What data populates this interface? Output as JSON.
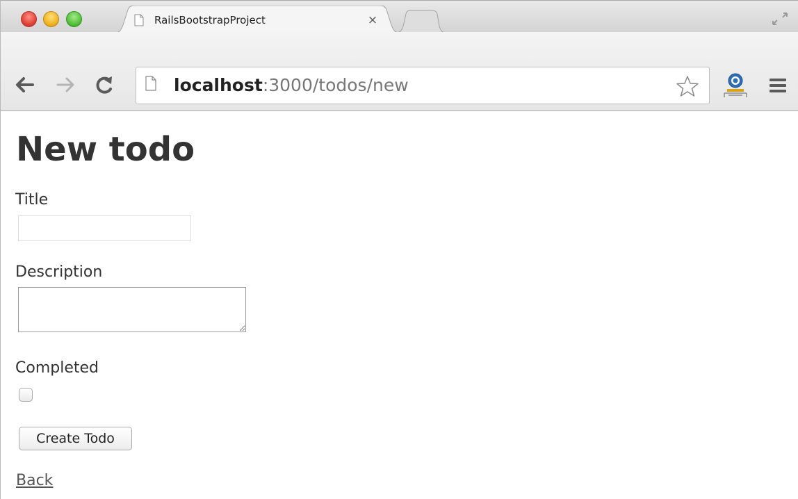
{
  "browser": {
    "tab": {
      "title": "RailsBootstrapProject",
      "close_glyph": "×"
    },
    "omnibox": {
      "host": "localhost",
      "rest": ":3000/todos/new"
    },
    "icons": {
      "back": "back-arrow-icon",
      "forward": "forward-arrow-icon",
      "reload": "reload-icon",
      "page": "page-icon",
      "star": "bookmark-star-icon",
      "extension": "extension-icon",
      "menu": "menu-icon",
      "fullscreen": "fullscreen-icon"
    },
    "colors": {
      "close": "#e0443a",
      "minimize": "#f2b424",
      "zoom": "#56c33a"
    }
  },
  "page": {
    "heading": "New todo",
    "form": {
      "title_label": "Title",
      "title_value": "",
      "description_label": "Description",
      "description_value": "",
      "completed_label": "Completed",
      "completed_checked": false,
      "submit_label": "Create Todo"
    },
    "back_link": "Back"
  }
}
